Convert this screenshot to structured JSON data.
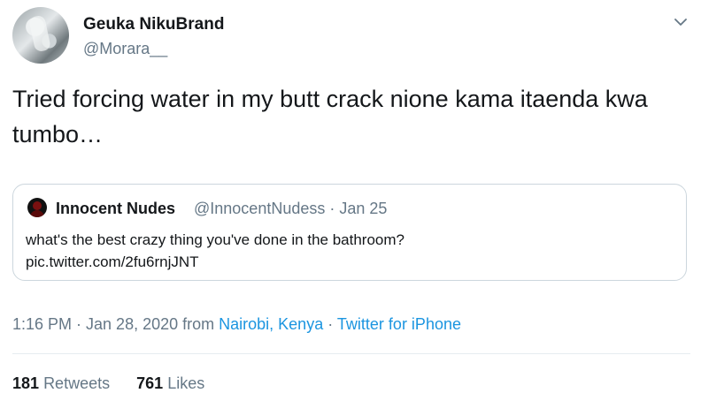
{
  "author": {
    "name": "Geuka NikuBrand",
    "handle": "@Morara__"
  },
  "tweet": {
    "text": "Tried forcing water in my butt crack nione kama itaenda kwa tumbo…"
  },
  "quoted": {
    "name": "Innocent Nudes",
    "meta": "@InnocentNudess · Jan 25",
    "text_line1": "what's the best crazy thing you've done in the bathroom?",
    "text_line2": "pic.twitter.com/2fu6rnjJNT"
  },
  "footer": {
    "time": "1:16 PM · Jan 28, 2020 from",
    "location": "Nairobi, Kenya",
    "separator": "·",
    "source": "Twitter for iPhone"
  },
  "stats": {
    "retweets_count": "181",
    "retweets_label": "Retweets",
    "likes_count": "761",
    "likes_label": "Likes"
  },
  "colors": {
    "link": "#1b95e0",
    "muted": "#657786",
    "border": "#ccd6dd"
  }
}
